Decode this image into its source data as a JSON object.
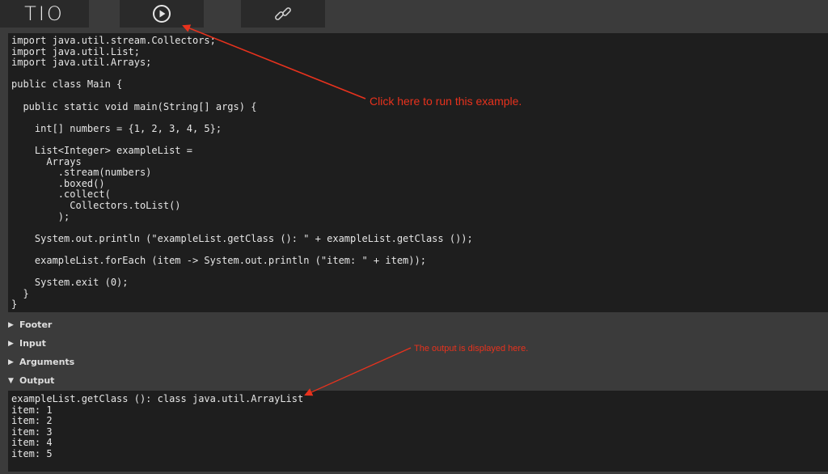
{
  "toolbar": {
    "logo": "TIO",
    "run_icon": "play-circle-icon",
    "permalink_icon": "link-icon"
  },
  "code_lines": [
    "import java.util.stream.Collectors;",
    "import java.util.List;",
    "import java.util.Arrays;",
    "",
    "public class Main {",
    "",
    "  public static void main(String[] args) {",
    "",
    "    int[] numbers = {1, 2, 3, 4, 5};",
    "",
    "    List<Integer> exampleList =",
    "      Arrays",
    "        .stream(numbers)",
    "        .boxed()",
    "        .collect(",
    "          Collectors.toList()",
    "        );",
    "",
    "    System.out.println (\"exampleList.getClass (): \" + exampleList.getClass ());",
    "",
    "    exampleList.forEach (item -> System.out.println (\"item: \" + item));",
    "",
    "    System.exit (0);",
    "  }",
    "}"
  ],
  "sections": {
    "footer": "Footer",
    "input": "Input",
    "arguments": "Arguments",
    "output": "Output"
  },
  "output_lines": [
    "exampleList.getClass (): class java.util.ArrayList",
    "item: 1",
    "item: 2",
    "item: 3",
    "item: 4",
    "item: 5"
  ],
  "annotations": {
    "run": "Click here to run this example.",
    "output": "The output is displayed here."
  },
  "colors": {
    "annotation": "#e8321d",
    "background": "#3b3b3b",
    "editor": "#1e1e1e"
  }
}
